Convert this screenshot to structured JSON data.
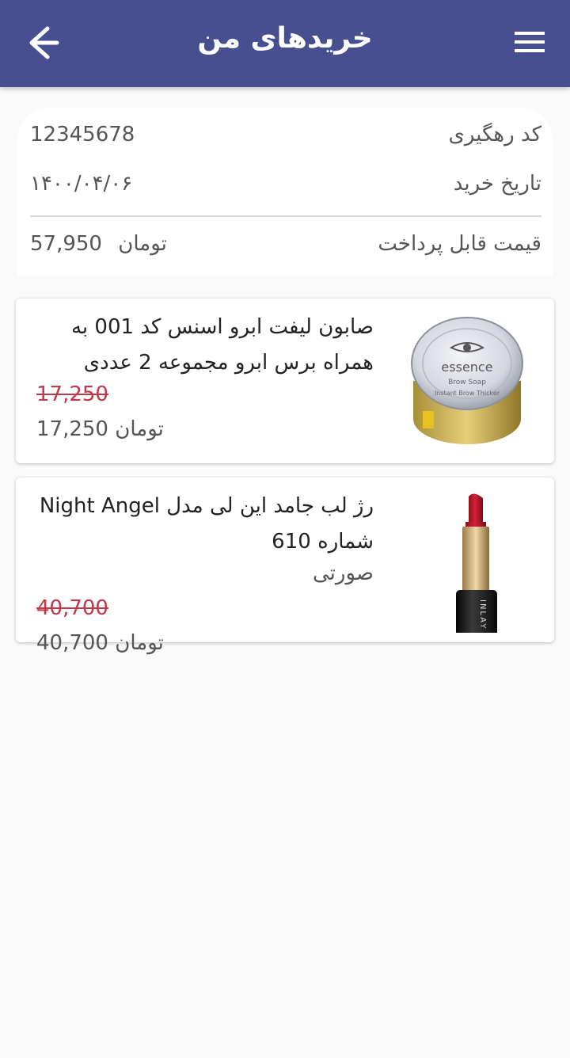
{
  "header": {
    "title": "خریدهای من",
    "back_icon": "arrow-left-icon",
    "menu_icon": "hamburger-menu-icon",
    "bg_color": "#474f91"
  },
  "summary": {
    "tracking_label": "کد رهگیری",
    "tracking_value": "12345678",
    "date_label": "تاریخ خرید",
    "date_value": "۱۴۰۰/۰۴/۰۶",
    "total_label": "قیمت قابل پرداخت",
    "total_value": "57,950",
    "total_currency": "تومان"
  },
  "orders": [
    {
      "name": "صابون لیفت ابرو اسنس کد 001 به همراه برس ابرو مجموعه 2 عددی",
      "variant": "",
      "old_price": "17,250",
      "price": "17,250",
      "currency": "تومان",
      "image": "brow-soap-jar-image",
      "jar_brand": "essence",
      "jar_line1": "Brow Soap",
      "jar_line2": "Instant Brow Thicker"
    },
    {
      "name": "رژ لب جامد این لی مدل Night Angel شماره 610",
      "variant": "صورتی",
      "old_price": "40,700",
      "price": "40,700",
      "currency": "تومان",
      "image": "lipstick-image",
      "tube_brand": "INLAY"
    }
  ],
  "colors": {
    "old_price": "#c0394b",
    "card_bg": "#ffffff",
    "page_bg": "#fafafa"
  }
}
